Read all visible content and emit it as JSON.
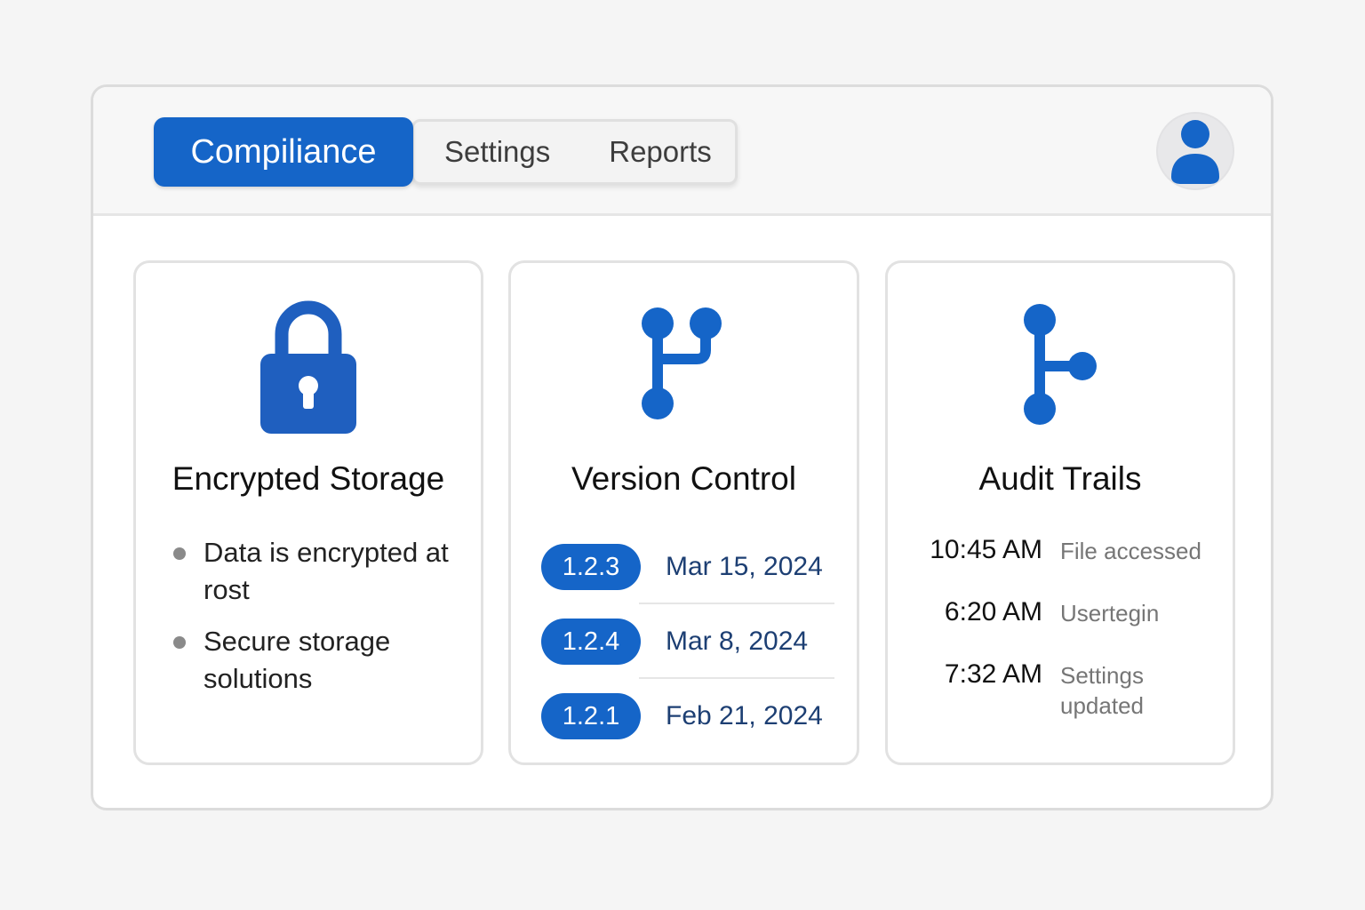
{
  "header": {
    "tabs": [
      {
        "label": "Compiliance",
        "active": true
      },
      {
        "label": "Settings",
        "active": false
      },
      {
        "label": "Reports",
        "active": false
      }
    ],
    "avatar_icon": "user-icon"
  },
  "colors": {
    "accent": "#1565c8",
    "icon_blue": "#1f5fbf",
    "date_text": "#1d3f73"
  },
  "cards": {
    "storage": {
      "icon": "lock-icon",
      "title": "Encrypted Storage",
      "bullets": [
        "Data is encrypted at rost",
        "Secure storage solutions"
      ]
    },
    "version": {
      "icon": "git-branch-icon",
      "title": "Version Control",
      "rows": [
        {
          "version": "1.2.3",
          "date": "Mar 15, 2024"
        },
        {
          "version": "1.2.4",
          "date": "Mar 8, 2024"
        },
        {
          "version": "1.2.1",
          "date": "Feb 21, 2024"
        }
      ]
    },
    "audit": {
      "icon": "branch-icon",
      "title": "Audit Trails",
      "events": [
        {
          "time": "10:45 AM",
          "event": "File accessed"
        },
        {
          "time": "6:20 AM",
          "event": "Usertegin"
        },
        {
          "time": "7:32 AM",
          "event": "Settings updated"
        }
      ]
    }
  }
}
